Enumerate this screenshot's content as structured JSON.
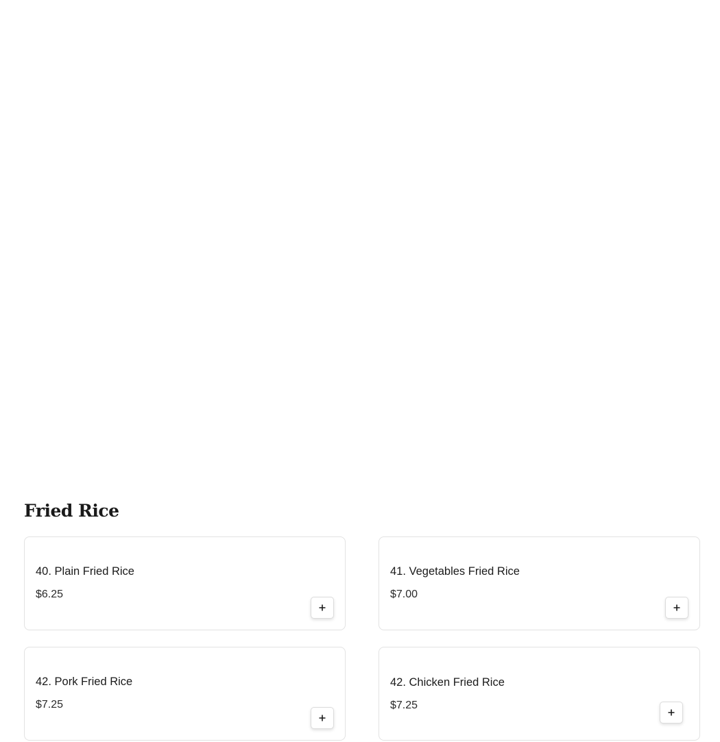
{
  "section": {
    "title": "Fried Rice"
  },
  "items": [
    {
      "name": "40. Plain Fried Rice",
      "price": "$6.25",
      "add_icon": "plus-icon"
    },
    {
      "name": "41. Vegetables Fried Rice",
      "price": "$7.00",
      "add_icon": "plus-icon"
    },
    {
      "name": "42. Pork Fried Rice",
      "price": "$7.25",
      "add_icon": "plus-icon"
    },
    {
      "name": "42. Chicken Fried Rice",
      "price": "$7.25",
      "add_icon": "plus-icon"
    }
  ]
}
